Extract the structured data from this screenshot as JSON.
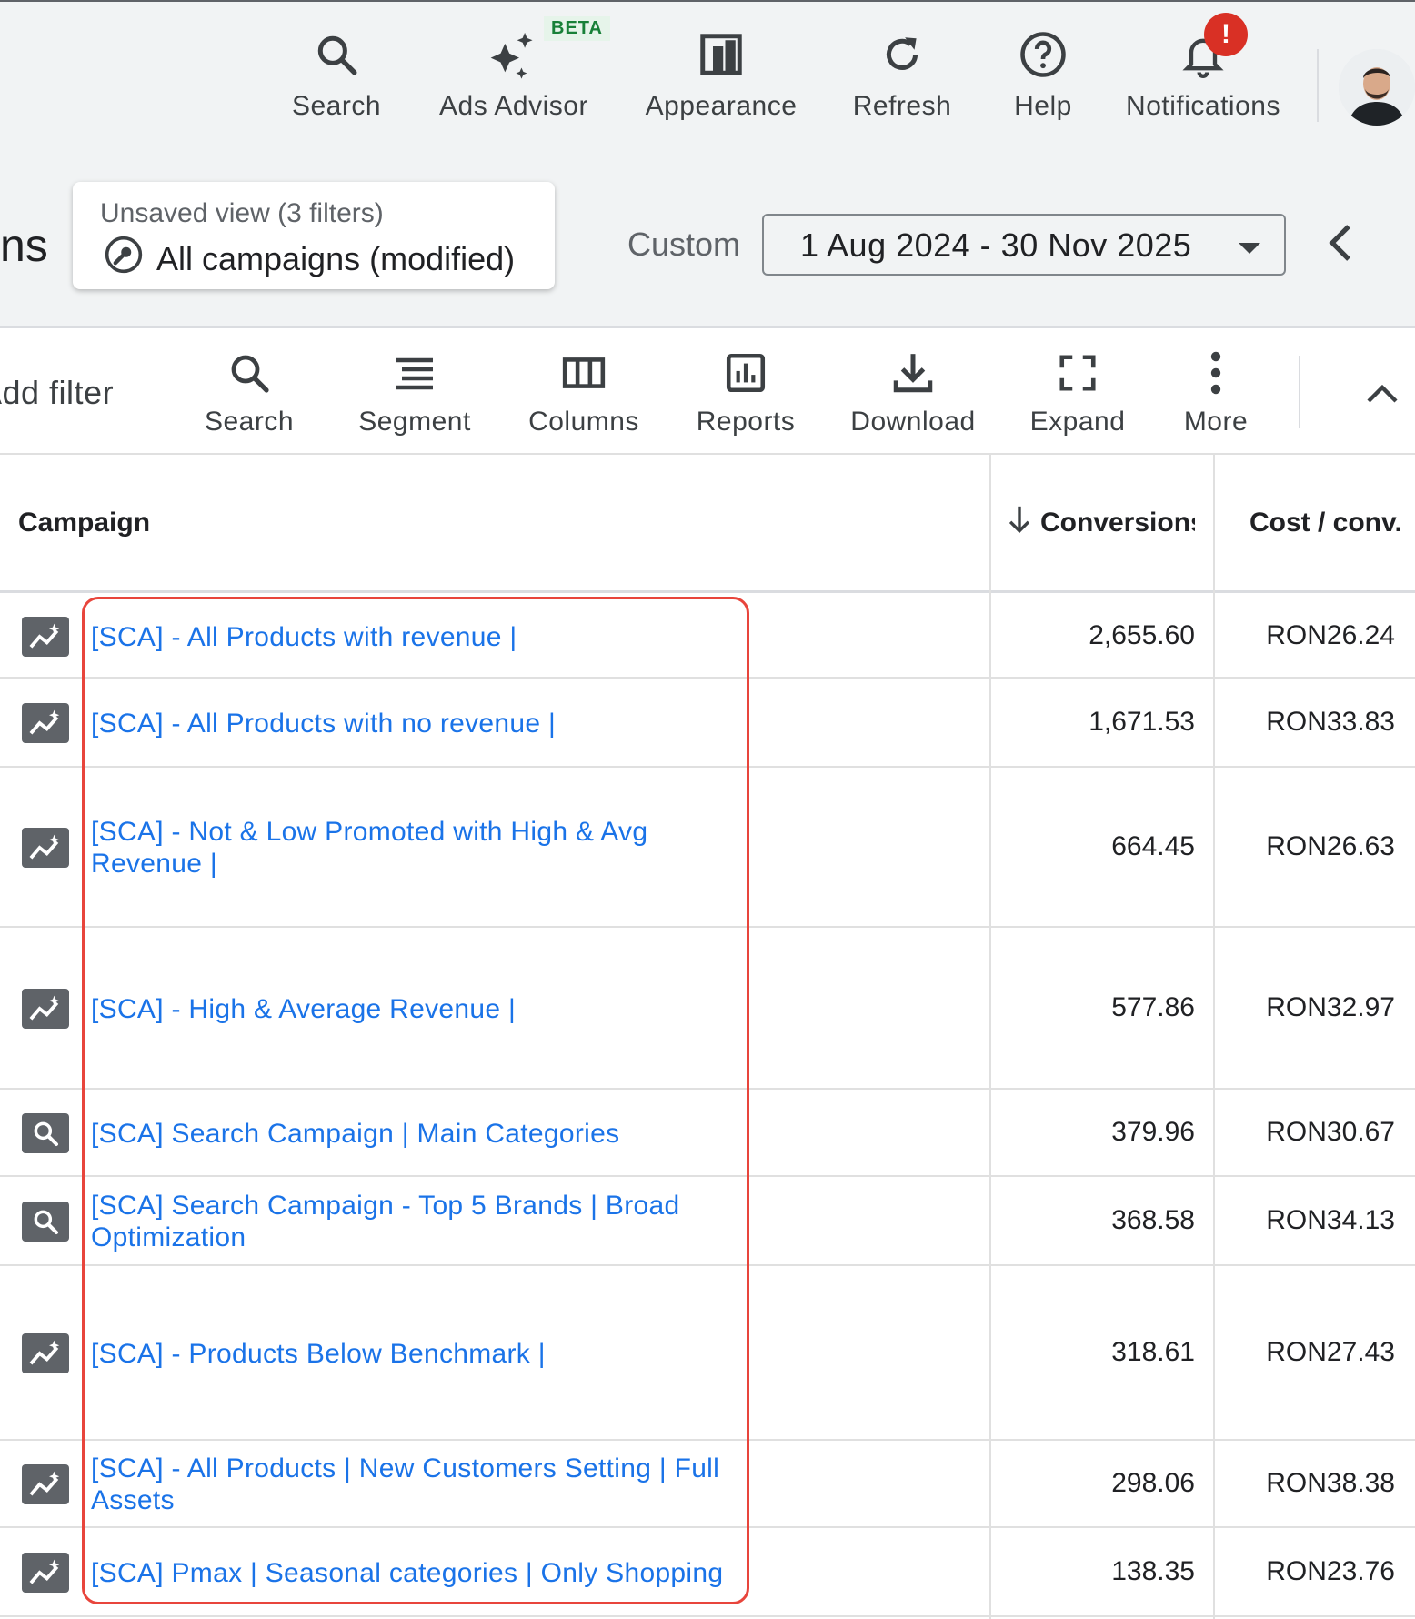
{
  "topnav": {
    "items": [
      {
        "label": "Search",
        "icon": "search-icon"
      },
      {
        "label": "Ads Advisor",
        "icon": "sparkle-icon"
      },
      {
        "label": "Appearance",
        "icon": "appearance-icon"
      },
      {
        "label": "Refresh",
        "icon": "refresh-icon"
      },
      {
        "label": "Help",
        "icon": "help-icon"
      },
      {
        "label": "Notifications",
        "icon": "bell-icon"
      }
    ],
    "beta_label": "BETA",
    "notification_badge": "!"
  },
  "page": {
    "title_fragment": "ns",
    "view_subtitle": "Unsaved view (3 filters)",
    "view_title": "All campaigns (modified)",
    "date_preset": "Custom",
    "date_range": "1 Aug 2024 - 30 Nov 2025"
  },
  "toolbar": {
    "add_filter": "Add filter",
    "items": [
      {
        "label": "Search",
        "icon": "search-icon"
      },
      {
        "label": "Segment",
        "icon": "segment-icon"
      },
      {
        "label": "Columns",
        "icon": "columns-icon"
      },
      {
        "label": "Reports",
        "icon": "reports-icon"
      },
      {
        "label": "Download",
        "icon": "download-icon"
      },
      {
        "label": "Expand",
        "icon": "expand-icon"
      },
      {
        "label": "More",
        "icon": "more-vert-icon"
      }
    ]
  },
  "table": {
    "columns": [
      "Campaign",
      "Conversions",
      "Cost / conv."
    ],
    "rows": [
      {
        "name": "[SCA] - All Products with revenue |",
        "type": "performance-max-icon",
        "conversions": "2,655.60",
        "cost_per_conv": "RON26.24"
      },
      {
        "name": "[SCA] - All Products with no revenue |",
        "type": "performance-max-icon",
        "conversions": "1,671.53",
        "cost_per_conv": "RON33.83"
      },
      {
        "name": "[SCA] - Not & Low Promoted with High & Avg Revenue |",
        "type": "performance-max-icon",
        "conversions": "664.45",
        "cost_per_conv": "RON26.63"
      },
      {
        "name": "[SCA] - High & Average Revenue |",
        "type": "performance-max-icon",
        "conversions": "577.86",
        "cost_per_conv": "RON32.97"
      },
      {
        "name": "[SCA] Search Campaign | Main Categories",
        "type": "search-campaign-icon",
        "conversions": "379.96",
        "cost_per_conv": "RON30.67"
      },
      {
        "name": "[SCA] Search Campaign - Top 5 Brands | Broad Optimization",
        "type": "search-campaign-icon",
        "conversions": "368.58",
        "cost_per_conv": "RON34.13"
      },
      {
        "name": "[SCA]  - Products Below Benchmark |",
        "type": "performance-max-icon",
        "conversions": "318.61",
        "cost_per_conv": "RON27.43"
      },
      {
        "name": "[SCA] - All Products |  New Customers Setting | Full Assets",
        "type": "performance-max-icon",
        "conversions": "298.06",
        "cost_per_conv": "RON38.38"
      },
      {
        "name": "[SCA] Pmax | Seasonal categories | Only Shopping",
        "type": "performance-max-icon",
        "conversions": "138.35",
        "cost_per_conv": "RON23.76"
      }
    ]
  },
  "colors": {
    "link": "#1a73e8",
    "highlight": "#e8453c",
    "badge": "#d93025"
  }
}
